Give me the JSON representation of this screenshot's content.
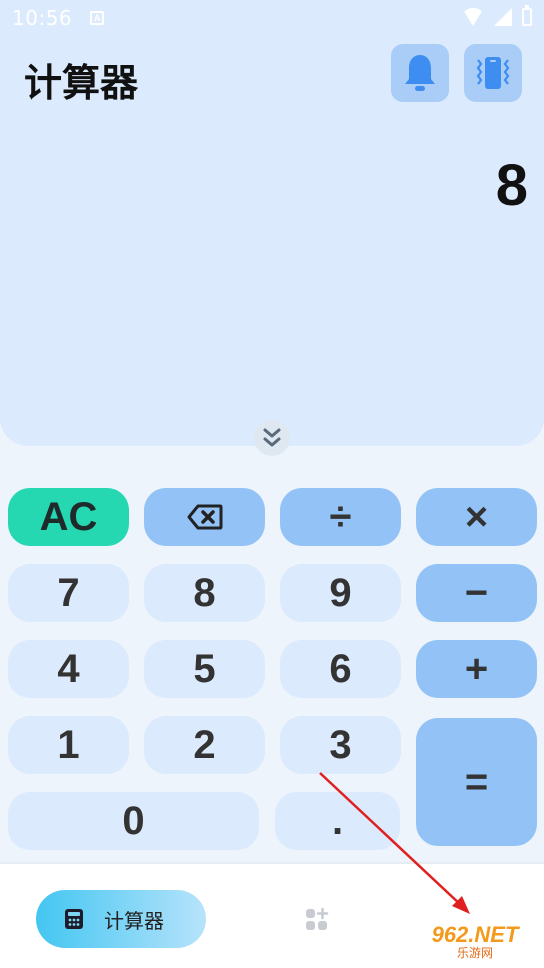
{
  "status_bar": {
    "time": "10:56",
    "notification_icon": "a-box-icon",
    "icons": [
      "wifi-icon",
      "signal-icon",
      "battery-icon"
    ]
  },
  "header": {
    "title": "计算器",
    "bell_icon": "bell-icon",
    "vibrate_icon": "vibrate-icon"
  },
  "display": {
    "value": "8",
    "collapse_icon": "double-chevron-down-icon"
  },
  "keypad": {
    "row1": [
      "AC",
      "backspace-icon",
      "÷",
      "×"
    ],
    "row2": [
      "7",
      "8",
      "9",
      "−"
    ],
    "row3": [
      "4",
      "5",
      "6",
      "+"
    ],
    "row4": [
      "1",
      "2",
      "3"
    ],
    "row5": [
      "0",
      "."
    ],
    "equals": "="
  },
  "bottom_nav": {
    "calculator_label": "计算器",
    "calculator_icon": "calculator-icon",
    "tools_icon": "grid-plus-icon"
  },
  "watermark": {
    "main": "962.NET",
    "sub": "乐游网"
  },
  "colors": {
    "panel_bg": "#dbeafc",
    "operator_key": "#93c2f7",
    "ac_key": "#25d8b2",
    "number_key": "#dbeafc",
    "arrow": "#e02020"
  }
}
